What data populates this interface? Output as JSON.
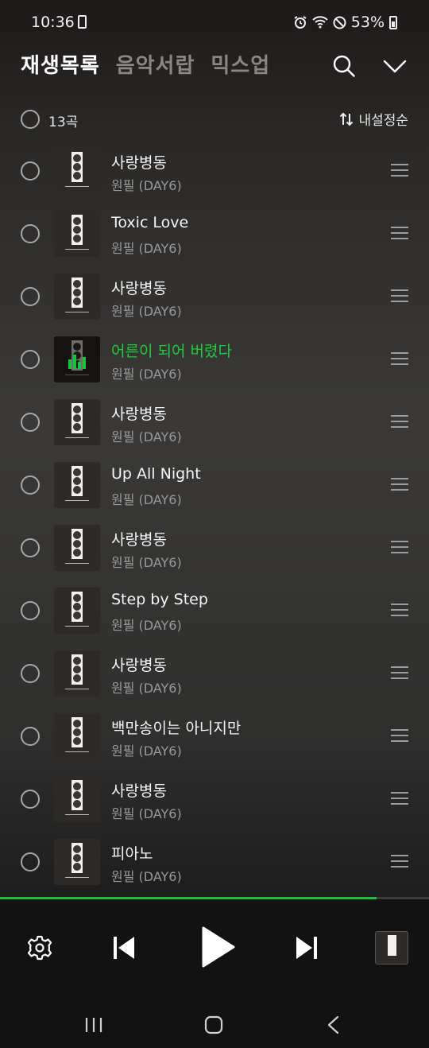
{
  "status": {
    "time": "10:36",
    "battery": "53%"
  },
  "header": {
    "tabs": [
      {
        "label": "재생목록",
        "active": true
      },
      {
        "label": "음악서랍",
        "active": false
      },
      {
        "label": "믹스업",
        "active": false
      }
    ],
    "icons": [
      "search-icon",
      "chevron-down-icon"
    ]
  },
  "selection": {
    "count": "13곡",
    "sort_label": "내설정순"
  },
  "tracks": [
    {
      "title": "사랑병동",
      "artist": "원필 (DAY6)",
      "playing": false
    },
    {
      "title": "Toxic Love",
      "artist": "원필 (DAY6)",
      "playing": false
    },
    {
      "title": "사랑병동",
      "artist": "원필 (DAY6)",
      "playing": false
    },
    {
      "title": "어른이 되어 버렸다",
      "artist": "원필 (DAY6)",
      "playing": true
    },
    {
      "title": "사랑병동",
      "artist": "원필 (DAY6)",
      "playing": false
    },
    {
      "title": "Up All Night",
      "artist": "원필 (DAY6)",
      "playing": false
    },
    {
      "title": "사랑병동",
      "artist": "원필 (DAY6)",
      "playing": false
    },
    {
      "title": "Step by Step",
      "artist": "원필 (DAY6)",
      "playing": false
    },
    {
      "title": "사랑병동",
      "artist": "원필 (DAY6)",
      "playing": false
    },
    {
      "title": "백만송이는 아니지만",
      "artist": "원필 (DAY6)",
      "playing": false
    },
    {
      "title": "사랑병동",
      "artist": "원필 (DAY6)",
      "playing": false
    },
    {
      "title": "피아노",
      "artist": "원필 (DAY6)",
      "playing": false
    }
  ],
  "player": {
    "progress_fraction": 0.877,
    "controls": [
      "gear-icon",
      "previous-icon",
      "play-icon",
      "next-icon"
    ]
  },
  "colors": {
    "accent": "#19c23c",
    "background": "#2f2e2c",
    "player_bg": "#121212"
  },
  "navbar": [
    "recents-icon",
    "home-icon",
    "back-icon"
  ]
}
